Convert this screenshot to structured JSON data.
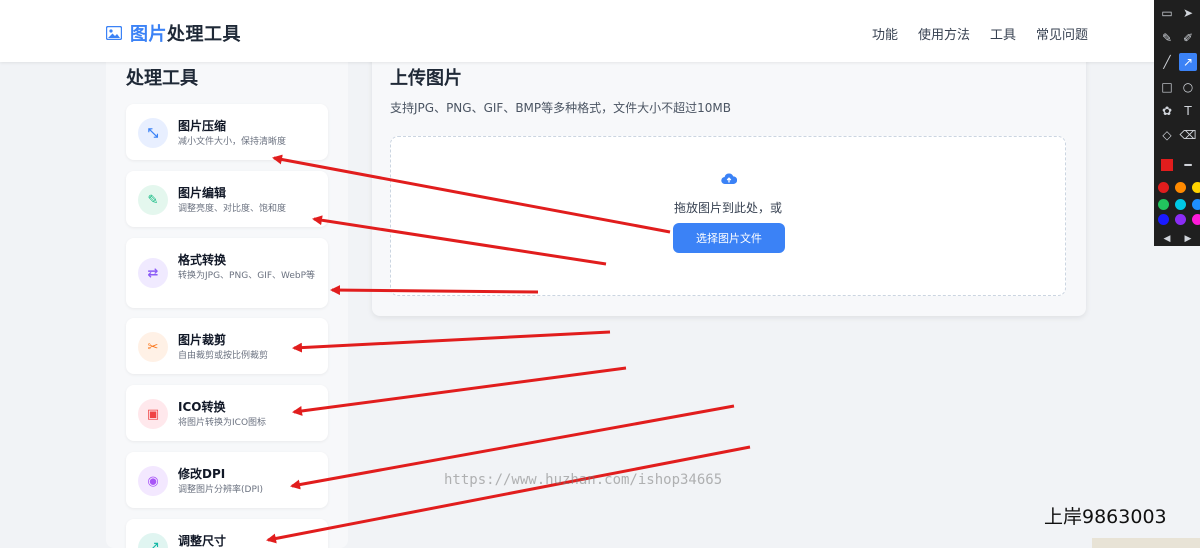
{
  "header": {
    "brand_accent": "图片",
    "brand_rest": "处理工具",
    "nav": [
      "功能",
      "使用方法",
      "工具",
      "常见问题"
    ]
  },
  "sidebar": {
    "title": "处理工具",
    "tools": [
      {
        "name": "图片压缩",
        "desc": "减小文件大小，保持清晰度",
        "icon": "compress-icon",
        "glyph": "⤡",
        "bg": "#e8efff",
        "fg": "#3b82f6"
      },
      {
        "name": "图片编辑",
        "desc": "调整亮度、对比度、饱和度",
        "icon": "brush-icon",
        "glyph": "✎",
        "bg": "#e4f7ee",
        "fg": "#10b981"
      },
      {
        "name": "格式转换",
        "desc": "转换为JPG、PNG、GIF、WebP等",
        "icon": "swap-icon",
        "glyph": "⇄",
        "bg": "#f0eaff",
        "fg": "#8b5cf6"
      },
      {
        "name": "图片裁剪",
        "desc": "自由裁剪或按比例裁剪",
        "icon": "scissors-icon",
        "glyph": "✂",
        "bg": "#fff1e6",
        "fg": "#f97316"
      },
      {
        "name": "ICO转换",
        "desc": "将图片转换为ICO图标",
        "icon": "image-file-icon",
        "glyph": "▣",
        "bg": "#ffe8ec",
        "fg": "#ef4444"
      },
      {
        "name": "修改DPI",
        "desc": "调整图片分辨率(DPI)",
        "icon": "target-icon",
        "glyph": "◉",
        "bg": "#f3e8ff",
        "fg": "#a855f7"
      },
      {
        "name": "调整尺寸",
        "desc": "",
        "icon": "resize-icon",
        "glyph": "⤢",
        "bg": "#e0f5f1",
        "fg": "#14b8a6"
      }
    ]
  },
  "main": {
    "title": "上传图片",
    "subtitle": "支持JPG、PNG、GIF、BMP等多种格式，文件大小不超过10MB",
    "drop_hint": "拖放图片到此处，或",
    "select_button": "选择图片文件"
  },
  "overlay": {
    "watermark": "https://www.huzhan.com/ishop34665",
    "badge": "上岸9863003"
  },
  "colors": {
    "accent": "#3b82f6",
    "arrow": "#e11d1d"
  },
  "toolbar": {
    "tools": [
      "presentation-icon",
      "cursor-icon",
      "pen-icon",
      "marker-icon",
      "line-icon",
      "arrow-icon",
      "rectangle-icon",
      "ellipse-icon",
      "highlighter-icon",
      "text-icon",
      "eraser-icon",
      "trash-icon",
      "stroke-width-icon",
      "prev-icon",
      "next-icon"
    ],
    "swatches": [
      "#e11d1d",
      "#ff8a00",
      "#ffd400",
      "#22c55e",
      "#00c8e6",
      "#1e90ff",
      "#1a1aff",
      "#8b2cf5",
      "#ff1ad9"
    ]
  }
}
